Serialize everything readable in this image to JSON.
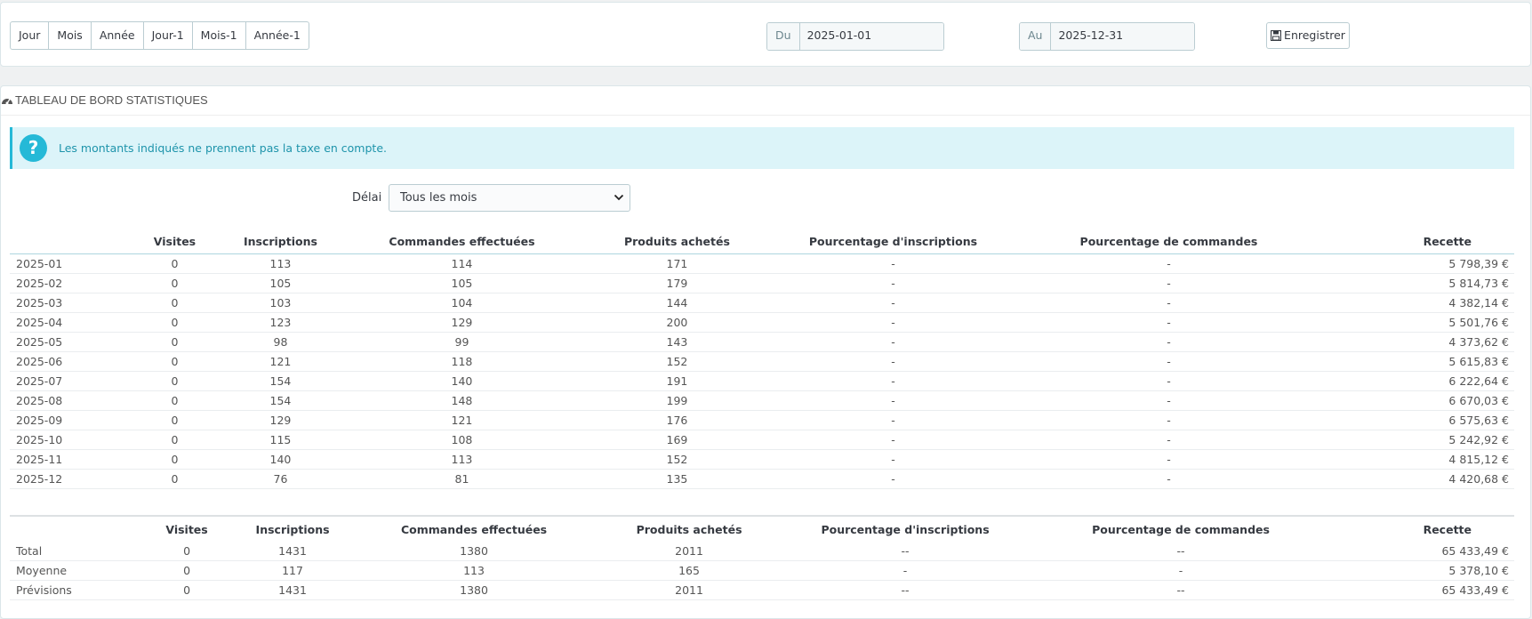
{
  "period_buttons": [
    "Jour",
    "Mois",
    "Année",
    "Jour-1",
    "Mois-1",
    "Année-1"
  ],
  "date_from": {
    "label": "Du",
    "value": "2025-01-01"
  },
  "date_to": {
    "label": "Au",
    "value": "2025-12-31"
  },
  "save_button": {
    "label": "Enregistrer",
    "icon": "save-icon"
  },
  "panel": {
    "title": "Tableau de bord statistiques",
    "icon": "dashboard-icon"
  },
  "alert": {
    "text": "Les montants indiqués ne prennent pas la taxe en compte.",
    "icon": "question-icon",
    "color": "#25b9d7"
  },
  "delai": {
    "label": "Délai",
    "selected": "Tous les mois"
  },
  "columns": [
    "",
    "Visites",
    "Inscriptions",
    "Commandes effectuées",
    "Produits achetés",
    "Pourcentage d'inscriptions",
    "Pourcentage de commandes",
    "Recette"
  ],
  "rows": [
    [
      "2025-01",
      "0",
      "113",
      "114",
      "171",
      "-",
      "-",
      "5 798,39 €"
    ],
    [
      "2025-02",
      "0",
      "105",
      "105",
      "179",
      "-",
      "-",
      "5 814,73 €"
    ],
    [
      "2025-03",
      "0",
      "103",
      "104",
      "144",
      "-",
      "-",
      "4 382,14 €"
    ],
    [
      "2025-04",
      "0",
      "123",
      "129",
      "200",
      "-",
      "-",
      "5 501,76 €"
    ],
    [
      "2025-05",
      "0",
      "98",
      "99",
      "143",
      "-",
      "-",
      "4 373,62 €"
    ],
    [
      "2025-06",
      "0",
      "121",
      "118",
      "152",
      "-",
      "-",
      "5 615,83 €"
    ],
    [
      "2025-07",
      "0",
      "154",
      "140",
      "191",
      "-",
      "-",
      "6 222,64 €"
    ],
    [
      "2025-08",
      "0",
      "154",
      "148",
      "199",
      "-",
      "-",
      "6 670,03 €"
    ],
    [
      "2025-09",
      "0",
      "129",
      "121",
      "176",
      "-",
      "-",
      "6 575,63 €"
    ],
    [
      "2025-10",
      "0",
      "115",
      "108",
      "169",
      "-",
      "-",
      "5 242,92 €"
    ],
    [
      "2025-11",
      "0",
      "140",
      "113",
      "152",
      "-",
      "-",
      "4 815,12 €"
    ],
    [
      "2025-12",
      "0",
      "76",
      "81",
      "135",
      "-",
      "-",
      "4 420,68 €"
    ]
  ],
  "totals": [
    [
      "Total",
      "0",
      "1431",
      "1380",
      "2011",
      "--",
      "--",
      "65 433,49 €"
    ],
    [
      "Moyenne",
      "0",
      "117",
      "113",
      "165",
      "-",
      "-",
      "5 378,10 €"
    ],
    [
      "Prévisions",
      "0",
      "1431",
      "1380",
      "2011",
      "--",
      "--",
      "65 433,49 €"
    ]
  ]
}
